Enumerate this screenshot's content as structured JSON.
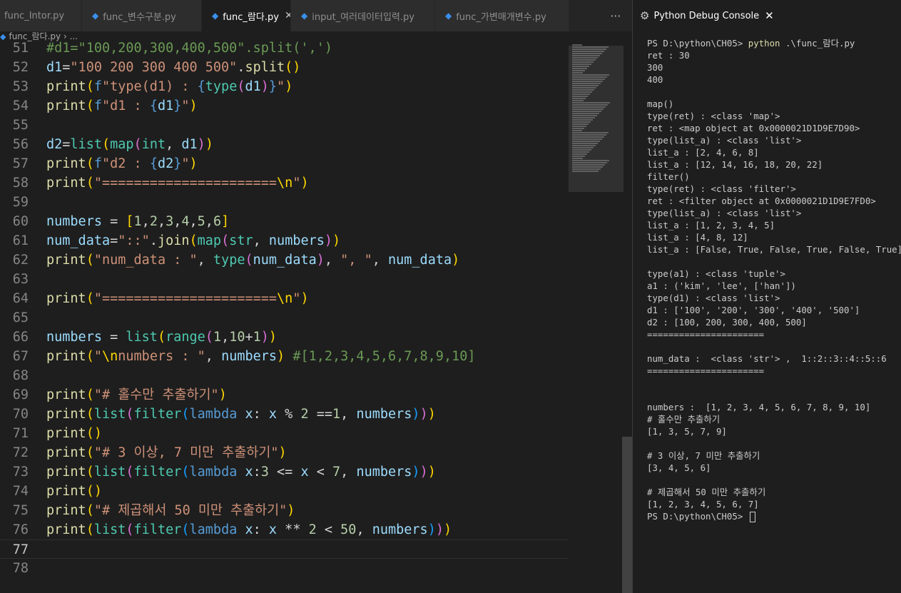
{
  "tabs": [
    {
      "label": "func_Intor.py",
      "active": false
    },
    {
      "label": "func_변수구분.py",
      "active": false
    },
    {
      "label": "func_람다.py",
      "active": true
    },
    {
      "label": "input_여러데이터입력.py",
      "active": false
    },
    {
      "label": "func_가변매개변수.py",
      "active": false
    }
  ],
  "tab_more": "⋯",
  "breadcrumb": {
    "file": "func_람다.py",
    "sep": "›",
    "more": "..."
  },
  "code_lines": [
    {
      "num": "51",
      "tokens": [
        {
          "t": "#d1=\"100,200,300,400,500\".split(',')",
          "c": "c"
        }
      ]
    },
    {
      "num": "52",
      "tokens": [
        {
          "t": "d1",
          "c": "v"
        },
        {
          "t": "=",
          "c": "o"
        },
        {
          "t": "\"100 200 300 400 500\"",
          "c": "s"
        },
        {
          "t": ".",
          "c": "o"
        },
        {
          "t": "split",
          "c": "f"
        },
        {
          "t": "()",
          "c": "b1"
        }
      ]
    },
    {
      "num": "53",
      "tokens": [
        {
          "t": "print",
          "c": "f"
        },
        {
          "t": "(",
          "c": "b1"
        },
        {
          "t": "f",
          "c": "k"
        },
        {
          "t": "\"type(d1) : ",
          "c": "s"
        },
        {
          "t": "{",
          "c": "k"
        },
        {
          "t": "type",
          "c": "cl"
        },
        {
          "t": "(",
          "c": "b2"
        },
        {
          "t": "d1",
          "c": "v"
        },
        {
          "t": ")",
          "c": "b2"
        },
        {
          "t": "}",
          "c": "k"
        },
        {
          "t": "\"",
          "c": "s"
        },
        {
          "t": ")",
          "c": "b1"
        }
      ]
    },
    {
      "num": "54",
      "tokens": [
        {
          "t": "print",
          "c": "f"
        },
        {
          "t": "(",
          "c": "b1"
        },
        {
          "t": "f",
          "c": "k"
        },
        {
          "t": "\"d1 : ",
          "c": "s"
        },
        {
          "t": "{",
          "c": "k"
        },
        {
          "t": "d1",
          "c": "v"
        },
        {
          "t": "}",
          "c": "k"
        },
        {
          "t": "\"",
          "c": "s"
        },
        {
          "t": ")",
          "c": "b1"
        }
      ]
    },
    {
      "num": "55",
      "tokens": []
    },
    {
      "num": "56",
      "tokens": [
        {
          "t": "d2",
          "c": "v"
        },
        {
          "t": "=",
          "c": "o"
        },
        {
          "t": "list",
          "c": "cl"
        },
        {
          "t": "(",
          "c": "b1"
        },
        {
          "t": "map",
          "c": "cl"
        },
        {
          "t": "(",
          "c": "b2"
        },
        {
          "t": "int",
          "c": "cl"
        },
        {
          "t": ", ",
          "c": "o"
        },
        {
          "t": "d1",
          "c": "v"
        },
        {
          "t": ")",
          "c": "b2"
        },
        {
          "t": ")",
          "c": "b1"
        }
      ]
    },
    {
      "num": "57",
      "tokens": [
        {
          "t": "print",
          "c": "f"
        },
        {
          "t": "(",
          "c": "b1"
        },
        {
          "t": "f",
          "c": "k"
        },
        {
          "t": "\"d2 : ",
          "c": "s"
        },
        {
          "t": "{",
          "c": "k"
        },
        {
          "t": "d2",
          "c": "v"
        },
        {
          "t": "}",
          "c": "k"
        },
        {
          "t": "\"",
          "c": "s"
        },
        {
          "t": ")",
          "c": "b1"
        }
      ]
    },
    {
      "num": "58",
      "tokens": [
        {
          "t": "print",
          "c": "f"
        },
        {
          "t": "(",
          "c": "b1"
        },
        {
          "t": "\"======================",
          "c": "s"
        },
        {
          "t": "\\n",
          "c": "b1"
        },
        {
          "t": "\"",
          "c": "s"
        },
        {
          "t": ")",
          "c": "b1"
        }
      ]
    },
    {
      "num": "59",
      "tokens": []
    },
    {
      "num": "60",
      "tokens": [
        {
          "t": "numbers",
          "c": "v"
        },
        {
          "t": " = ",
          "c": "o"
        },
        {
          "t": "[",
          "c": "b1"
        },
        {
          "t": "1",
          "c": "n"
        },
        {
          "t": ",",
          "c": "o"
        },
        {
          "t": "2",
          "c": "n"
        },
        {
          "t": ",",
          "c": "o"
        },
        {
          "t": "3",
          "c": "n"
        },
        {
          "t": ",",
          "c": "o"
        },
        {
          "t": "4",
          "c": "n"
        },
        {
          "t": ",",
          "c": "o"
        },
        {
          "t": "5",
          "c": "n"
        },
        {
          "t": ",",
          "c": "o"
        },
        {
          "t": "6",
          "c": "n"
        },
        {
          "t": "]",
          "c": "b1"
        }
      ]
    },
    {
      "num": "61",
      "tokens": [
        {
          "t": "num_data",
          "c": "v"
        },
        {
          "t": "=",
          "c": "o"
        },
        {
          "t": "\"::\"",
          "c": "s"
        },
        {
          "t": ".",
          "c": "o"
        },
        {
          "t": "join",
          "c": "f"
        },
        {
          "t": "(",
          "c": "b1"
        },
        {
          "t": "map",
          "c": "cl"
        },
        {
          "t": "(",
          "c": "b2"
        },
        {
          "t": "str",
          "c": "cl"
        },
        {
          "t": ", ",
          "c": "o"
        },
        {
          "t": "numbers",
          "c": "v"
        },
        {
          "t": ")",
          "c": "b2"
        },
        {
          "t": ")",
          "c": "b1"
        }
      ]
    },
    {
      "num": "62",
      "tokens": [
        {
          "t": "print",
          "c": "f"
        },
        {
          "t": "(",
          "c": "b1"
        },
        {
          "t": "\"num_data : \"",
          "c": "s"
        },
        {
          "t": ", ",
          "c": "o"
        },
        {
          "t": "type",
          "c": "cl"
        },
        {
          "t": "(",
          "c": "b2"
        },
        {
          "t": "num_data",
          "c": "v"
        },
        {
          "t": ")",
          "c": "b2"
        },
        {
          "t": ", ",
          "c": "o"
        },
        {
          "t": "\", \"",
          "c": "s"
        },
        {
          "t": ", ",
          "c": "o"
        },
        {
          "t": "num_data",
          "c": "v"
        },
        {
          "t": ")",
          "c": "b1"
        }
      ]
    },
    {
      "num": "63",
      "tokens": []
    },
    {
      "num": "64",
      "tokens": [
        {
          "t": "print",
          "c": "f"
        },
        {
          "t": "(",
          "c": "b1"
        },
        {
          "t": "\"======================",
          "c": "s"
        },
        {
          "t": "\\n",
          "c": "b1"
        },
        {
          "t": "\"",
          "c": "s"
        },
        {
          "t": ")",
          "c": "b1"
        }
      ]
    },
    {
      "num": "65",
      "tokens": []
    },
    {
      "num": "66",
      "tokens": [
        {
          "t": "numbers",
          "c": "v"
        },
        {
          "t": " = ",
          "c": "o"
        },
        {
          "t": "list",
          "c": "cl"
        },
        {
          "t": "(",
          "c": "b1"
        },
        {
          "t": "range",
          "c": "cl"
        },
        {
          "t": "(",
          "c": "b2"
        },
        {
          "t": "1",
          "c": "n"
        },
        {
          "t": ",",
          "c": "o"
        },
        {
          "t": "10",
          "c": "n"
        },
        {
          "t": "+",
          "c": "o"
        },
        {
          "t": "1",
          "c": "n"
        },
        {
          "t": ")",
          "c": "b2"
        },
        {
          "t": ")",
          "c": "b1"
        }
      ]
    },
    {
      "num": "67",
      "tokens": [
        {
          "t": "print",
          "c": "f"
        },
        {
          "t": "(",
          "c": "b1"
        },
        {
          "t": "\"",
          "c": "s"
        },
        {
          "t": "\\n",
          "c": "b1"
        },
        {
          "t": "numbers : \"",
          "c": "s"
        },
        {
          "t": ", ",
          "c": "o"
        },
        {
          "t": "numbers",
          "c": "v"
        },
        {
          "t": ")",
          "c": "b1"
        },
        {
          "t": " #[1,2,3,4,5,6,7,8,9,10]",
          "c": "c"
        }
      ]
    },
    {
      "num": "68",
      "tokens": []
    },
    {
      "num": "69",
      "tokens": [
        {
          "t": "print",
          "c": "f"
        },
        {
          "t": "(",
          "c": "b1"
        },
        {
          "t": "\"# 홀수만 추출하기\"",
          "c": "s"
        },
        {
          "t": ")",
          "c": "b1"
        }
      ]
    },
    {
      "num": "70",
      "tokens": [
        {
          "t": "print",
          "c": "f"
        },
        {
          "t": "(",
          "c": "b1"
        },
        {
          "t": "list",
          "c": "cl"
        },
        {
          "t": "(",
          "c": "b2"
        },
        {
          "t": "filter",
          "c": "cl"
        },
        {
          "t": "(",
          "c": "b3"
        },
        {
          "t": "lambda",
          "c": "k"
        },
        {
          "t": " x",
          "c": "v"
        },
        {
          "t": ": ",
          "c": "o"
        },
        {
          "t": "x",
          "c": "v"
        },
        {
          "t": " % ",
          "c": "o"
        },
        {
          "t": "2",
          "c": "n"
        },
        {
          "t": " ==",
          "c": "o"
        },
        {
          "t": "1",
          "c": "n"
        },
        {
          "t": ", ",
          "c": "o"
        },
        {
          "t": "numbers",
          "c": "v"
        },
        {
          "t": ")",
          "c": "b3"
        },
        {
          "t": ")",
          "c": "b2"
        },
        {
          "t": ")",
          "c": "b1"
        }
      ]
    },
    {
      "num": "71",
      "tokens": [
        {
          "t": "print",
          "c": "f"
        },
        {
          "t": "()",
          "c": "b1"
        }
      ]
    },
    {
      "num": "72",
      "tokens": [
        {
          "t": "print",
          "c": "f"
        },
        {
          "t": "(",
          "c": "b1"
        },
        {
          "t": "\"# 3 이상, 7 미만 추출하기\"",
          "c": "s"
        },
        {
          "t": ")",
          "c": "b1"
        }
      ]
    },
    {
      "num": "73",
      "tokens": [
        {
          "t": "print",
          "c": "f"
        },
        {
          "t": "(",
          "c": "b1"
        },
        {
          "t": "list",
          "c": "cl"
        },
        {
          "t": "(",
          "c": "b2"
        },
        {
          "t": "filter",
          "c": "cl"
        },
        {
          "t": "(",
          "c": "b3"
        },
        {
          "t": "lambda",
          "c": "k"
        },
        {
          "t": " x",
          "c": "v"
        },
        {
          "t": ":",
          "c": "o"
        },
        {
          "t": "3",
          "c": "n"
        },
        {
          "t": " <= ",
          "c": "o"
        },
        {
          "t": "x",
          "c": "v"
        },
        {
          "t": " < ",
          "c": "o"
        },
        {
          "t": "7",
          "c": "n"
        },
        {
          "t": ", ",
          "c": "o"
        },
        {
          "t": "numbers",
          "c": "v"
        },
        {
          "t": ")",
          "c": "b3"
        },
        {
          "t": ")",
          "c": "b2"
        },
        {
          "t": ")",
          "c": "b1"
        }
      ]
    },
    {
      "num": "74",
      "tokens": [
        {
          "t": "print",
          "c": "f"
        },
        {
          "t": "()",
          "c": "b1"
        }
      ]
    },
    {
      "num": "75",
      "tokens": [
        {
          "t": "print",
          "c": "f"
        },
        {
          "t": "(",
          "c": "b1"
        },
        {
          "t": "\"# 제곱해서 50 미만 추출하기\"",
          "c": "s"
        },
        {
          "t": ")",
          "c": "b1"
        }
      ]
    },
    {
      "num": "76",
      "tokens": [
        {
          "t": "print",
          "c": "f"
        },
        {
          "t": "(",
          "c": "b1"
        },
        {
          "t": "list",
          "c": "cl"
        },
        {
          "t": "(",
          "c": "b2"
        },
        {
          "t": "filter",
          "c": "cl"
        },
        {
          "t": "(",
          "c": "b3"
        },
        {
          "t": "lambda",
          "c": "k"
        },
        {
          "t": " x",
          "c": "v"
        },
        {
          "t": ": ",
          "c": "o"
        },
        {
          "t": "x",
          "c": "v"
        },
        {
          "t": " ** ",
          "c": "o"
        },
        {
          "t": "2",
          "c": "n"
        },
        {
          "t": " < ",
          "c": "o"
        },
        {
          "t": "50",
          "c": "n"
        },
        {
          "t": ", ",
          "c": "o"
        },
        {
          "t": "numbers",
          "c": "v"
        },
        {
          "t": ")",
          "c": "b3"
        },
        {
          "t": ")",
          "c": "b2"
        },
        {
          "t": ")",
          "c": "b1"
        }
      ]
    },
    {
      "num": "77",
      "tokens": [],
      "current": true
    },
    {
      "num": "78",
      "tokens": []
    }
  ],
  "panel": {
    "title": "Python Debug Console",
    "close": "✕"
  },
  "terminal": {
    "prompt": "PS D:\\python\\CH05> ",
    "command": "python",
    "command_args": " .\\func_람다.py",
    "lines": [
      "ret : 30",
      "300",
      "400",
      "",
      "map()",
      "type(ret) : <class 'map'>",
      "ret : <map object at 0x0000021D1D9E7D90>",
      "type(list_a) : <class 'list'>",
      "list_a : [2, 4, 6, 8]",
      "list_a : [12, 14, 16, 18, 20, 22]",
      "filter()",
      "type(ret) : <class 'filter'>",
      "ret : <filter object at 0x0000021D1D9E7FD0>",
      "type(list_a) : <class 'list'>",
      "list_a : [1, 2, 3, 4, 5]",
      "list_a : [4, 8, 12]",
      "list_a : [False, True, False, True, False, True]",
      "",
      "type(a1) : <class 'tuple'>",
      "a1 : ('kim', 'lee', ['han'])",
      "type(d1) : <class 'list'>",
      "d1 : ['100', '200', '300', '400', '500']",
      "d2 : [100, 200, 300, 400, 500]",
      "======================",
      "",
      "num_data :  <class 'str'> ,  1::2::3::4::5::6",
      "======================",
      "",
      "",
      "numbers :  [1, 2, 3, 4, 5, 6, 7, 8, 9, 10]",
      "# 홀수만 추출하기",
      "[1, 3, 5, 7, 9]",
      "",
      "# 3 이상, 7 미만 추출하기",
      "[3, 4, 5, 6]",
      "",
      "# 제곱해서 50 미만 추출하기",
      "[1, 2, 3, 4, 5, 6, 7]"
    ],
    "final_prompt": "PS D:\\python\\CH05> "
  }
}
